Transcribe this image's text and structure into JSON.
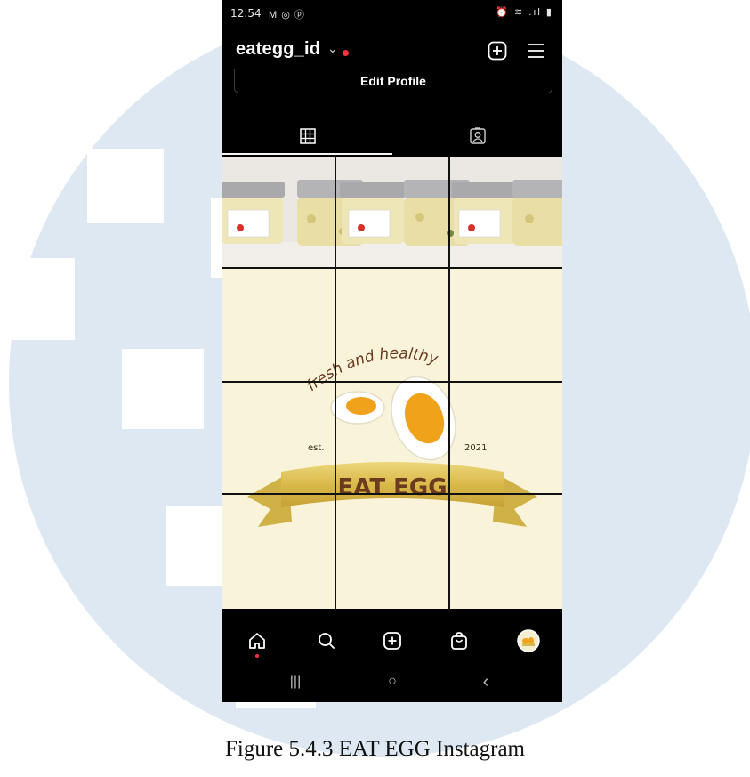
{
  "status_bar": {
    "time": "12:54",
    "notification_icons": "M ◎ ⓟ",
    "system_icons": "⏰ ≋ .ıl ▮"
  },
  "profile": {
    "username": "eategg_id",
    "switch_account_icon": "chevron-down-icon",
    "edit_profile_label": "Edit Profile"
  },
  "tabs": [
    {
      "name": "posts",
      "icon": "grid-icon",
      "active": true
    },
    {
      "name": "tagged",
      "icon": "tagged-icon",
      "active": false
    }
  ],
  "post_grid": {
    "logo_text": {
      "tagline": "fresh and healthy",
      "est_label": "est.",
      "year": "2021",
      "brand": "EAT EGG"
    }
  },
  "bottom_nav": [
    {
      "name": "home",
      "icon": "home-icon"
    },
    {
      "name": "search",
      "icon": "search-icon"
    },
    {
      "name": "create",
      "icon": "plus-square-icon"
    },
    {
      "name": "shop",
      "icon": "shop-bag-icon"
    },
    {
      "name": "profile",
      "icon": "avatar"
    }
  ],
  "android_nav": {
    "recents": "|||",
    "home": "○",
    "back": "‹"
  },
  "caption": "Figure 5.4.3 EAT EGG Instagram",
  "colors": {
    "background_watermark": "#dde8f2",
    "phone_bg": "#000000",
    "notification_dot": "#ff3040",
    "logo_cream": "#f9f3d9",
    "ribbon_gold": "#e0c35a",
    "brand_brown": "#6b3a1f",
    "yolk": "#f1a21b"
  }
}
